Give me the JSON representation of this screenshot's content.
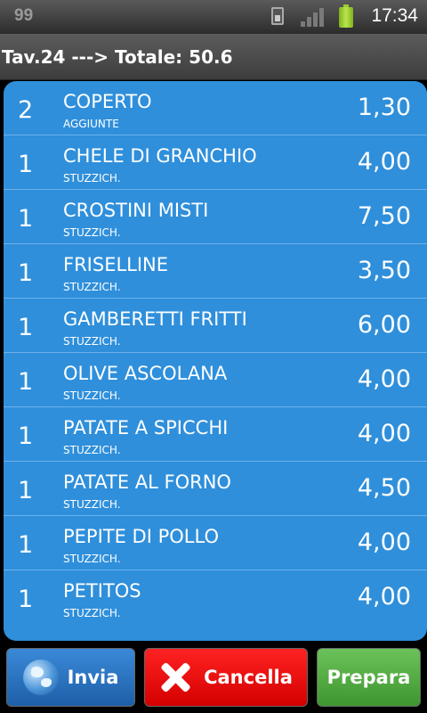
{
  "status_bar": {
    "notification": "99",
    "time": "17:34",
    "icons": [
      "sim-card-icon",
      "signal-icon",
      "battery-icon"
    ],
    "battery_color": "#9ccc30"
  },
  "header": {
    "title": "Tav.24 ---> Totale: 50.6"
  },
  "items": [
    {
      "qty": "2",
      "name": "COPERTO",
      "category": "AGGIUNTE",
      "price": "1,30"
    },
    {
      "qty": "1",
      "name": "CHELE DI GRANCHIO",
      "category": "STUZZICH.",
      "price": "4,00"
    },
    {
      "qty": "1",
      "name": "CROSTINI MISTI",
      "category": "STUZZICH.",
      "price": "7,50"
    },
    {
      "qty": "1",
      "name": "FRISELLINE",
      "category": "STUZZICH.",
      "price": "3,50"
    },
    {
      "qty": "1",
      "name": "GAMBERETTI FRITTI",
      "category": "STUZZICH.",
      "price": "6,00"
    },
    {
      "qty": "1",
      "name": "OLIVE ASCOLANA",
      "category": "STUZZICH.",
      "price": "4,00"
    },
    {
      "qty": "1",
      "name": "PATATE A SPICCHI",
      "category": "STUZZICH.",
      "price": "4,00"
    },
    {
      "qty": "1",
      "name": "PATATE AL FORNO",
      "category": "STUZZICH.",
      "price": "4,50"
    },
    {
      "qty": "1",
      "name": "PEPITE DI POLLO",
      "category": "STUZZICH.",
      "price": "4,00"
    },
    {
      "qty": "1",
      "name": "PETITOS",
      "category": "STUZZICH.",
      "price": "4,00"
    }
  ],
  "actions": {
    "invia": {
      "label": "Invia",
      "icon": "globe-icon",
      "color": "#2a74c4"
    },
    "cancella": {
      "label": "Cancella",
      "icon": "close-icon",
      "color": "#ff1111"
    },
    "prepara": {
      "label": "Prepara",
      "color": "#52aa40"
    }
  },
  "colors": {
    "list_background": "#2f8fdb",
    "row_divider": "#6db1ea"
  }
}
